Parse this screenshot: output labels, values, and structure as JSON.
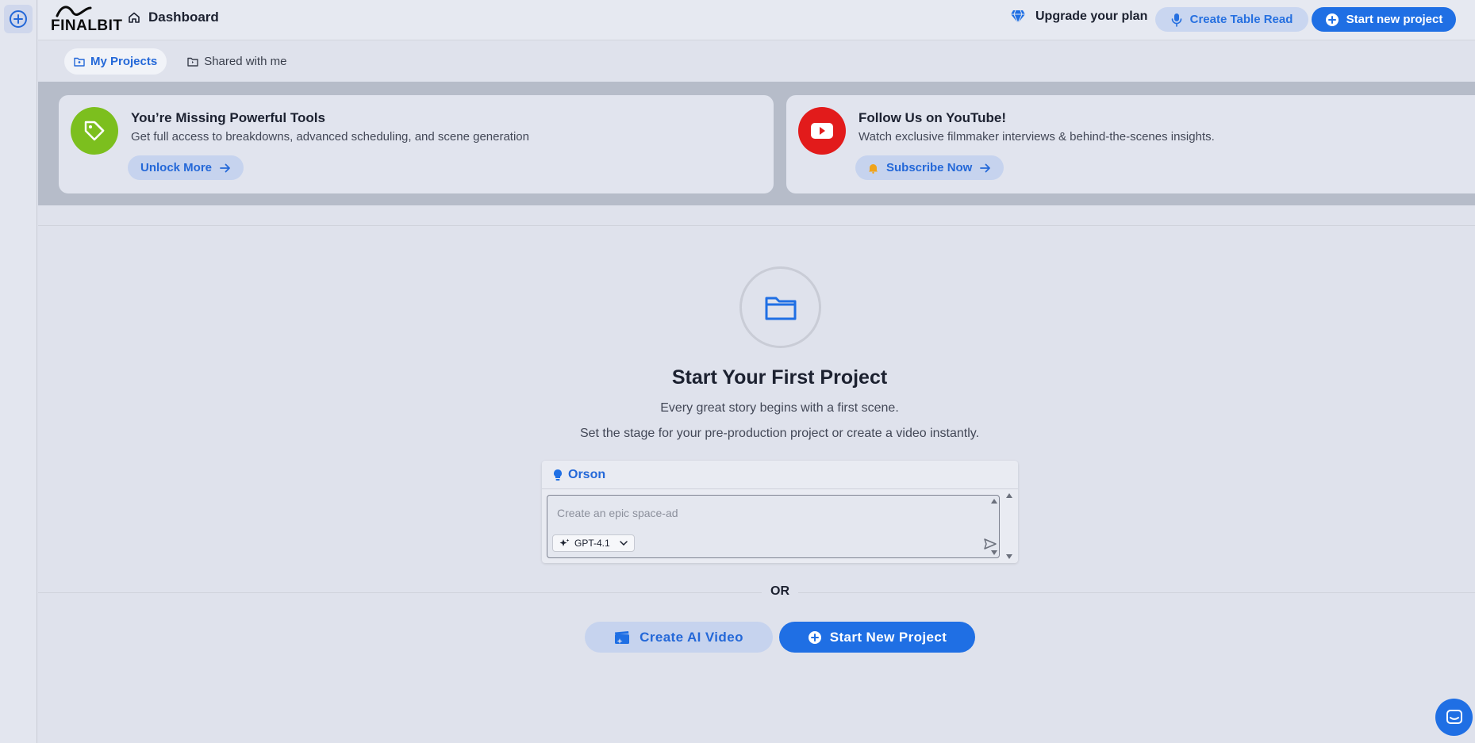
{
  "app": {
    "logo_text": "FINALBIT",
    "page_title": "Dashboard"
  },
  "header": {
    "upgrade_label": "Upgrade your plan",
    "table_read_label": "Create Table Read",
    "start_new_label": "Start new project"
  },
  "tabs": [
    {
      "label": "My Projects",
      "active": true
    },
    {
      "label": "Shared with me",
      "active": false
    }
  ],
  "banners": [
    {
      "title": "You’re Missing Powerful Tools",
      "description": "Get full access to breakdowns, advanced scheduling, and scene generation",
      "button": "Unlock More",
      "icon": "tag-icon",
      "color": "#7cbf1e"
    },
    {
      "title": "Follow Us on YouTube!",
      "description": "Watch exclusive filmmaker interviews & behind-the-scenes insights.",
      "button": "Subscribe Now",
      "icon": "youtube-icon",
      "color": "#e21b1b"
    }
  ],
  "empty_state": {
    "title": "Start Your First Project",
    "line1": "Every great story begins with a first scene.",
    "line2": "Set the stage for your pre-production project or create a video instantly."
  },
  "orson": {
    "name": "Orson",
    "placeholder": "Create an epic space-ad",
    "model": "GPT-4.1"
  },
  "divider_label": "OR",
  "actions": {
    "ai_video": "Create AI Video",
    "new_project": "Start New Project"
  },
  "colors": {
    "accent": "#1f6fe4",
    "accent_soft": "#c6d3ee",
    "background": "#dfe2ec"
  }
}
